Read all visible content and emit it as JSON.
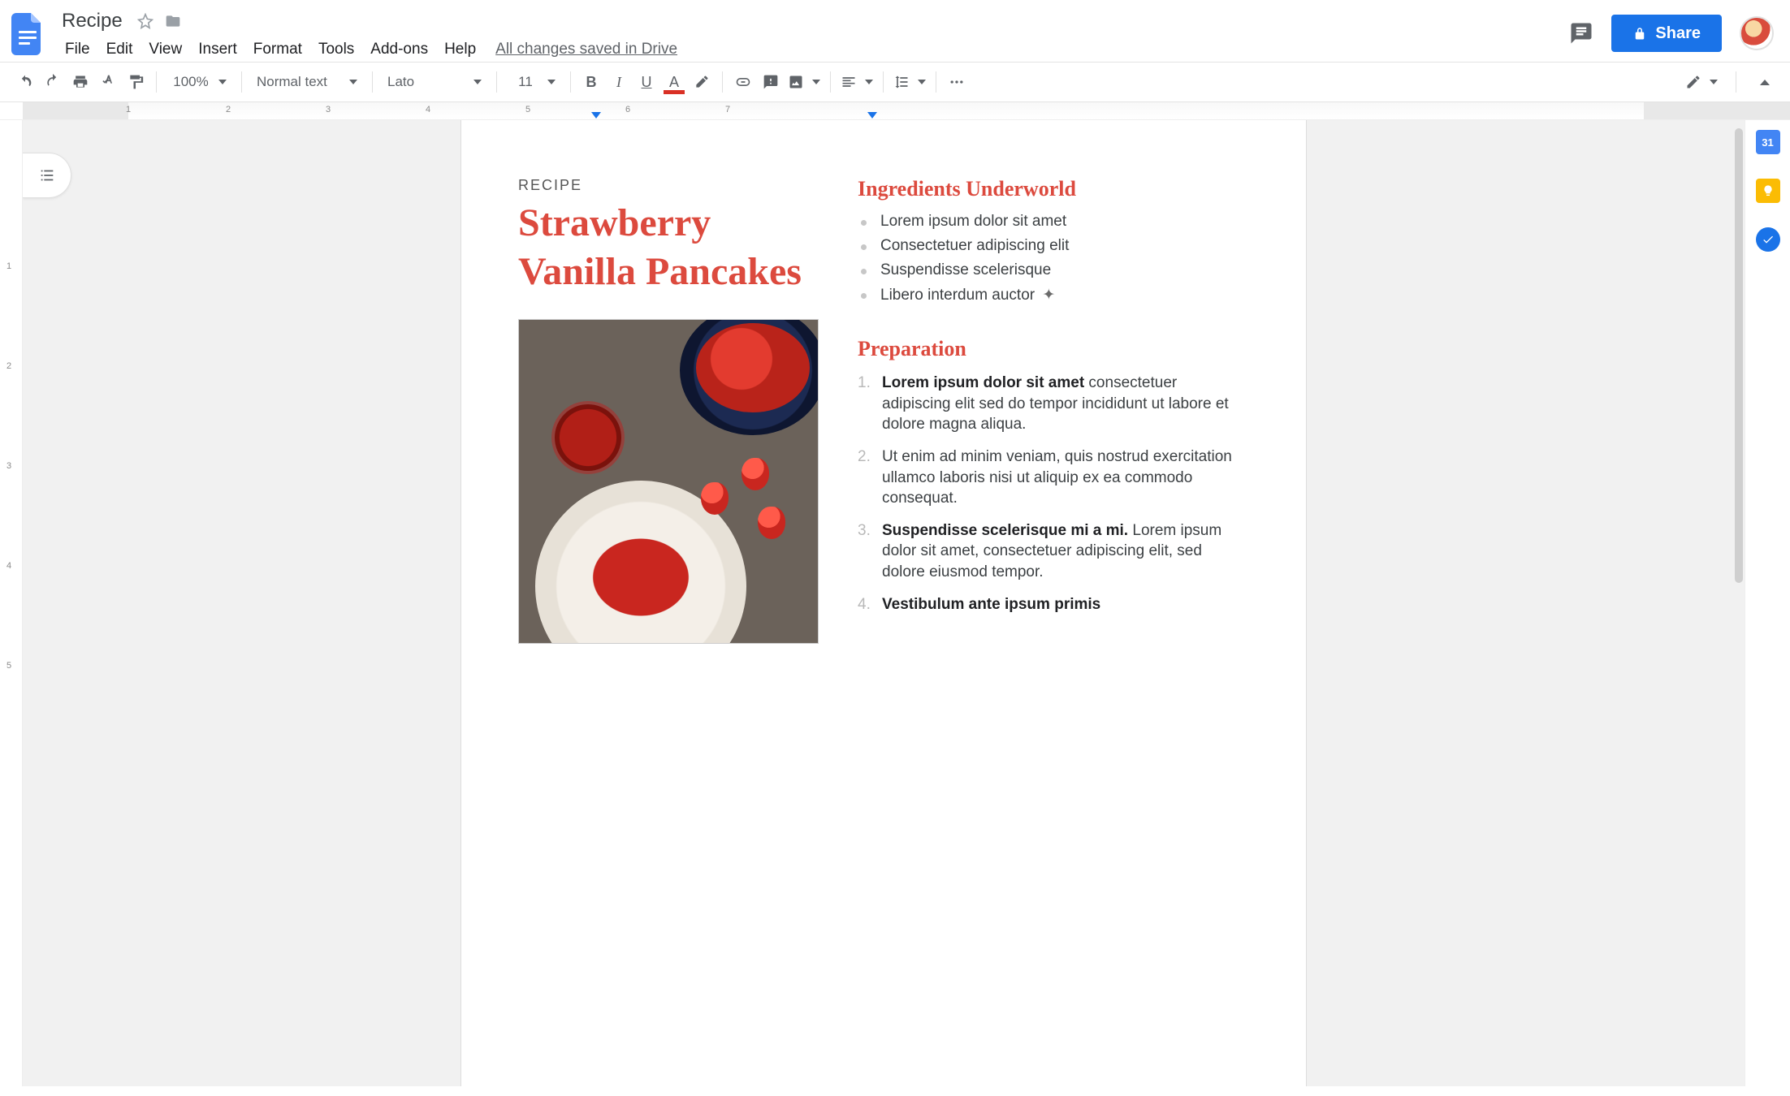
{
  "header": {
    "doc_title": "Recipe",
    "menus": [
      "File",
      "Edit",
      "View",
      "Insert",
      "Format",
      "Tools",
      "Add-ons",
      "Help"
    ],
    "save_status": "All changes saved in Drive",
    "share_label": "Share"
  },
  "toolbar": {
    "zoom": "100%",
    "style": "Normal text",
    "font": "Lato",
    "font_size": "11"
  },
  "ruler": {
    "h_numbers": [
      1,
      2,
      3,
      4,
      5,
      6,
      7
    ],
    "v_numbers": [
      1,
      2,
      3,
      4,
      5
    ]
  },
  "sidepanel": {
    "calendar_badge": "31"
  },
  "document": {
    "kicker": "RECIPE",
    "title": "Strawberry Vanilla Pancakes",
    "ingredients_heading": "Ingredients Underworld",
    "ingredients": [
      "Lorem ipsum dolor sit amet",
      "Consectetuer adipiscing elit",
      "Suspendisse scelerisque",
      "Libero interdum auctor"
    ],
    "ingredient_marker": "✦",
    "prep_heading": "Preparation",
    "prep_steps": [
      {
        "bold": "Lorem ipsum dolor sit amet",
        "rest": " consectetuer adipiscing elit sed do tempor incididunt ut labore et dolore magna aliqua."
      },
      {
        "bold": "",
        "rest": "Ut enim ad minim veniam, quis nostrud exercitation ullamco laboris nisi ut aliquip ex ea commodo consequat."
      },
      {
        "bold": "Suspendisse scelerisque mi a mi.",
        "rest": " Lorem ipsum dolor sit amet, consectetuer adipiscing elit, sed dolore eiusmod tempor."
      },
      {
        "bold": "Vestibulum ante ipsum primis",
        "rest": ""
      }
    ]
  }
}
